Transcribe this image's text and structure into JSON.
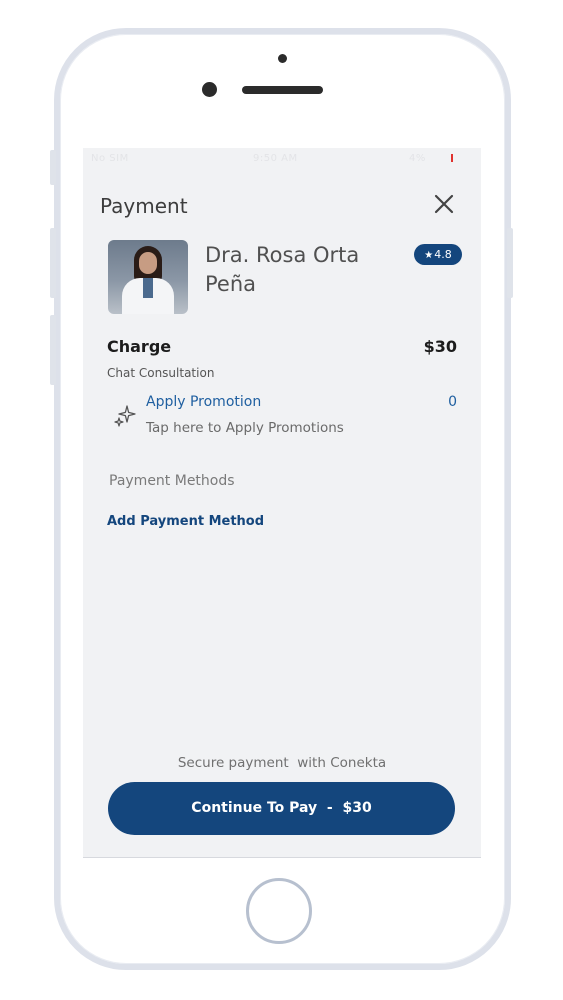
{
  "status_bar": {
    "carrier": "No SIM",
    "time": "9:50 AM",
    "battery": "4%"
  },
  "header": {
    "title": "Payment",
    "close_icon": "close-icon"
  },
  "doctor": {
    "name": "Dra. Rosa Orta Peña",
    "rating": "4.8",
    "rating_icon": "star-icon"
  },
  "charge": {
    "label": "Charge",
    "amount": "$30",
    "description": "Chat Consultation"
  },
  "promotion": {
    "title": "Apply Promotion",
    "subtitle": "Tap here to Apply Promotions",
    "count": "0",
    "icon": "sparkle-icon"
  },
  "payment_methods": {
    "label": "Payment Methods",
    "add_label": "Add Payment Method"
  },
  "footer": {
    "secure_text": "Secure payment  with Conekta",
    "pay_button": "Continue To Pay  -  $30"
  },
  "colors": {
    "primary": "#14467d",
    "link": "#1f5fa0",
    "background": "#f1f2f4"
  }
}
